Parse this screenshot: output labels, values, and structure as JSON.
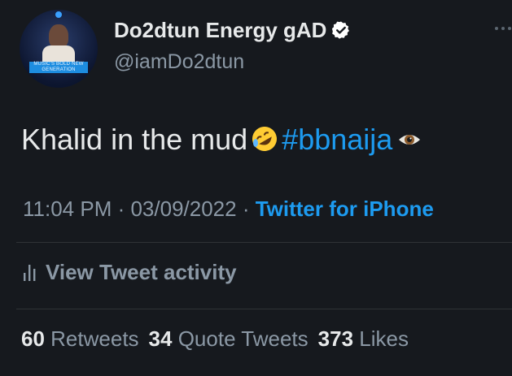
{
  "author": {
    "display_name": "Do2dtun Energy gAD",
    "handle": "@iamDo2dtun",
    "avatar_text": "MUSIC'S BOLD NEW GENERATION"
  },
  "tweet": {
    "text": "Khalid in the mud",
    "emoji_1": "rolling-on-floor-laughing-emoji",
    "hashtag": "#bbnaija",
    "emoji_2": "eye-emoji"
  },
  "meta": {
    "time": "11:04 PM",
    "separator_1": " · ",
    "date": "03/09/2022",
    "separator_2": " · ",
    "source": "Twitter for iPhone"
  },
  "activity": {
    "label": "View Tweet activity",
    "icon": "bar-chart-icon"
  },
  "stats": {
    "retweets_count": "60",
    "retweets_label": "Retweets",
    "quotes_count": "34",
    "quotes_label": "Quote Tweets",
    "likes_count": "373",
    "likes_label": "Likes"
  },
  "colors": {
    "background": "#16191e",
    "text": "#e7e9ea",
    "muted": "#8b98a5",
    "link": "#1d9bf0",
    "divider": "#2f3336"
  }
}
